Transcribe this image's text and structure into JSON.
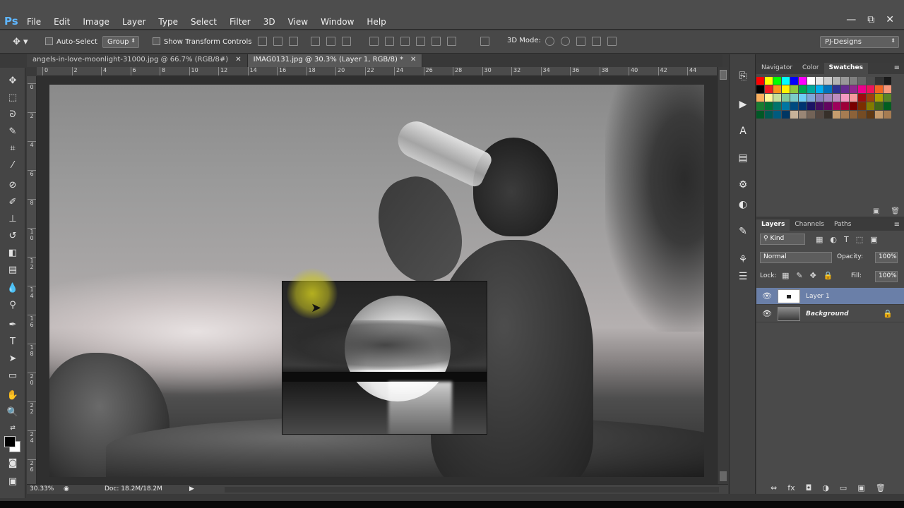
{
  "app": {
    "logo": "Ps"
  },
  "menu": [
    "File",
    "Edit",
    "Image",
    "Layer",
    "Type",
    "Select",
    "Filter",
    "3D",
    "View",
    "Window",
    "Help"
  ],
  "window_controls": {
    "minimize": "—",
    "restore": "⧉",
    "close": "✕"
  },
  "options": {
    "auto_select_label": "Auto-Select",
    "auto_select_value": "Group",
    "show_transform_label": "Show Transform Controls",
    "mode_3d_label": "3D Mode:",
    "workspace": "PJ-Designs"
  },
  "tabs": [
    {
      "label": "angels-in-love-moonlight-31000.jpg @ 66.7% (RGB/8#)",
      "close": "✕"
    },
    {
      "label": "IMAG0131.jpg @ 30.3% (Layer 1, RGB/8) *",
      "close": "✕"
    }
  ],
  "ruler_h": [
    "0",
    "2",
    "4",
    "6",
    "8",
    "10",
    "12",
    "14",
    "16",
    "18",
    "20",
    "22",
    "24",
    "26",
    "28",
    "30",
    "32",
    "34",
    "36",
    "38",
    "40",
    "42",
    "44"
  ],
  "ruler_v": [
    "0",
    "2",
    "4",
    "6",
    "8",
    "1 0",
    "1 2",
    "1 4",
    "1 6",
    "1 8",
    "2 0",
    "2 2",
    "2 4",
    "2 6"
  ],
  "status": {
    "zoom": "30.33%",
    "doc": "Doc: 18.2M/18.2M"
  },
  "swatch_panel": {
    "tabs": [
      "Navigator",
      "Color",
      "Swatches"
    ],
    "active": "Swatches"
  },
  "swatch_colors": [
    "#ff0000",
    "#ffff00",
    "#00ff00",
    "#00ffff",
    "#0000ff",
    "#ff00ff",
    "#ffffff",
    "#e6e6e6",
    "#cccccc",
    "#b3b3b3",
    "#999999",
    "#808080",
    "#666666",
    "#4d4d4d",
    "#333333",
    "#1a1a1a",
    "#000000",
    "#ed1c24",
    "#f7941d",
    "#fff200",
    "#8dc63f",
    "#00a651",
    "#00a99d",
    "#00aeef",
    "#0072bc",
    "#2e3192",
    "#662d91",
    "#92278f",
    "#ec008c",
    "#ed145b",
    "#f26522",
    "#f7977a",
    "#fbaf5d",
    "#fff79a",
    "#c4df9b",
    "#82ca9c",
    "#7accc8",
    "#6dcff6",
    "#7da7d9",
    "#8781bd",
    "#a186be",
    "#bd8cbf",
    "#f49ac2",
    "#f6989d",
    "#9e0b0f",
    "#a0410d",
    "#aba000",
    "#598527",
    "#197b30",
    "#007236",
    "#00746b",
    "#0076a3",
    "#004a80",
    "#003471",
    "#1b1464",
    "#440e62",
    "#630460",
    "#9e005d",
    "#9e0039",
    "#790000",
    "#7b2e00",
    "#827b00",
    "#406618",
    "#005e20",
    "#005826",
    "#005952",
    "#005b7f",
    "#003663",
    "#c7b299",
    "#998675",
    "#736357",
    "#534741",
    "#37302a",
    "#c69c6d",
    "#a67c52",
    "#8c6239",
    "#754c24",
    "#603913",
    "#c69c6d",
    "#a67c52"
  ],
  "layers_panel": {
    "tabs": [
      "Layers",
      "Channels",
      "Paths"
    ],
    "active": "Layers",
    "kind": "Kind",
    "blend_mode": "Normal",
    "opacity_label": "Opacity:",
    "opacity": "100%",
    "lock_label": "Lock:",
    "fill_label": "Fill:",
    "fill": "100%",
    "layers": [
      {
        "name": "Layer 1",
        "visible": "👁"
      },
      {
        "name": "Background",
        "visible": "👁",
        "lock": "🔒"
      }
    ],
    "footer": [
      "⇔",
      "fx",
      "◘",
      "◑",
      "▭",
      "▣",
      "🗑"
    ]
  }
}
